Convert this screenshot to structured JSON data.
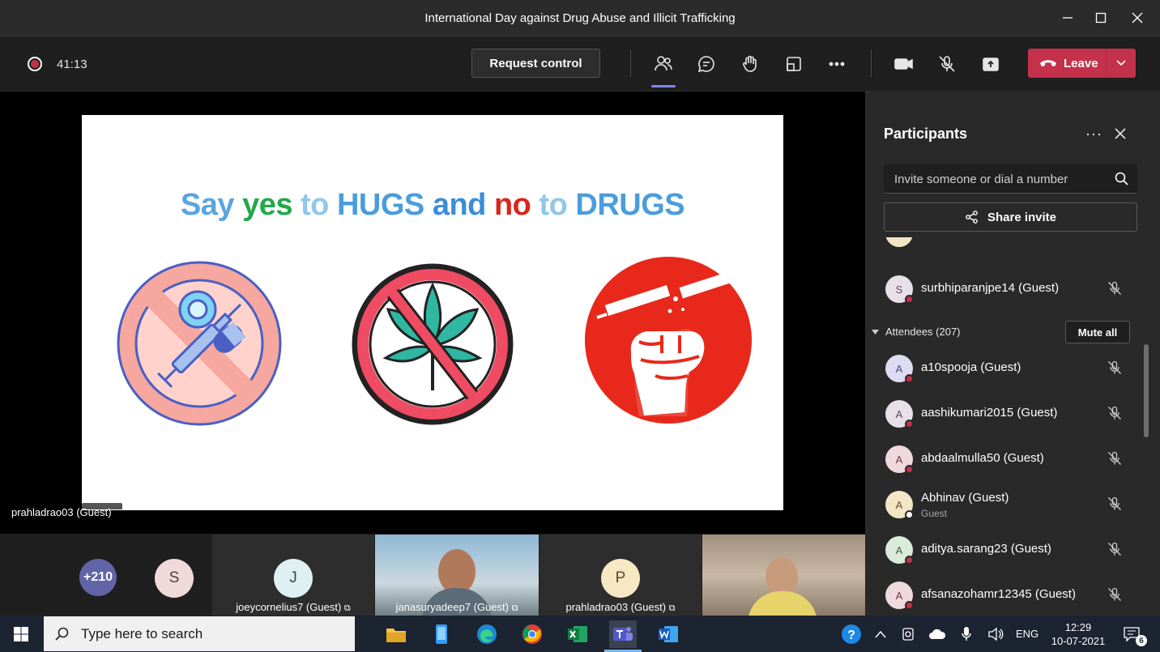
{
  "window": {
    "title": "International Day against Drug Abuse and Illicit Trafficking"
  },
  "meeting": {
    "timer": "41:13",
    "request_control_label": "Request control",
    "leave_label": "Leave"
  },
  "slide": {
    "title_words": [
      {
        "text": "Say",
        "color": "#5aa5e0"
      },
      {
        "text": "yes",
        "color": "#23a84a"
      },
      {
        "text": "to",
        "color": "#8fc8ea"
      },
      {
        "text": "HUGS",
        "color": "#4a9ddc"
      },
      {
        "text": "and",
        "color": "#3a8ed6"
      },
      {
        "text": "no",
        "color": "#d9261c"
      },
      {
        "text": "to",
        "color": "#8fc8ea"
      },
      {
        "text": "DRUGS",
        "color": "#4a9ddc"
      }
    ]
  },
  "stage": {
    "presenter_name": "prahladrao03 (Guest)"
  },
  "gallery": {
    "overflow_count": "+210",
    "tiles": [
      {
        "initial": "S",
        "name": ""
      },
      {
        "initial": "J",
        "name": "joeycornelius7 (Guest)"
      },
      {
        "initial": "",
        "name": "janasuryadeep7 (Guest)"
      },
      {
        "initial": "P",
        "name": "prahladrao03 (Guest)"
      },
      {
        "initial": "",
        "name": ""
      }
    ]
  },
  "panel": {
    "title": "Participants",
    "invite_placeholder": "Invite someone or dial a number",
    "share_invite_label": "Share invite",
    "presenter_row": {
      "initial": "S",
      "name": "surbhiparanjpe14 (Guest)"
    },
    "attendees_header": "Attendees (207)",
    "mute_all_label": "Mute all",
    "attendees": [
      {
        "initial": "A",
        "name": "a10spooja (Guest)",
        "sub": ""
      },
      {
        "initial": "A",
        "name": "aashikumari2015 (Guest)",
        "sub": ""
      },
      {
        "initial": "A",
        "name": "abdaalmulla50 (Guest)",
        "sub": ""
      },
      {
        "initial": "A",
        "name": "Abhinav (Guest)",
        "sub": "Guest"
      },
      {
        "initial": "A",
        "name": "aditya.sarang23 (Guest)",
        "sub": ""
      },
      {
        "initial": "A",
        "name": "afsanazohamr12345 (Guest)",
        "sub": ""
      }
    ]
  },
  "taskbar": {
    "search_placeholder": "Type here to search",
    "language": "ENG",
    "time": "12:29",
    "date": "10-07-2021",
    "notification_count": "6"
  }
}
